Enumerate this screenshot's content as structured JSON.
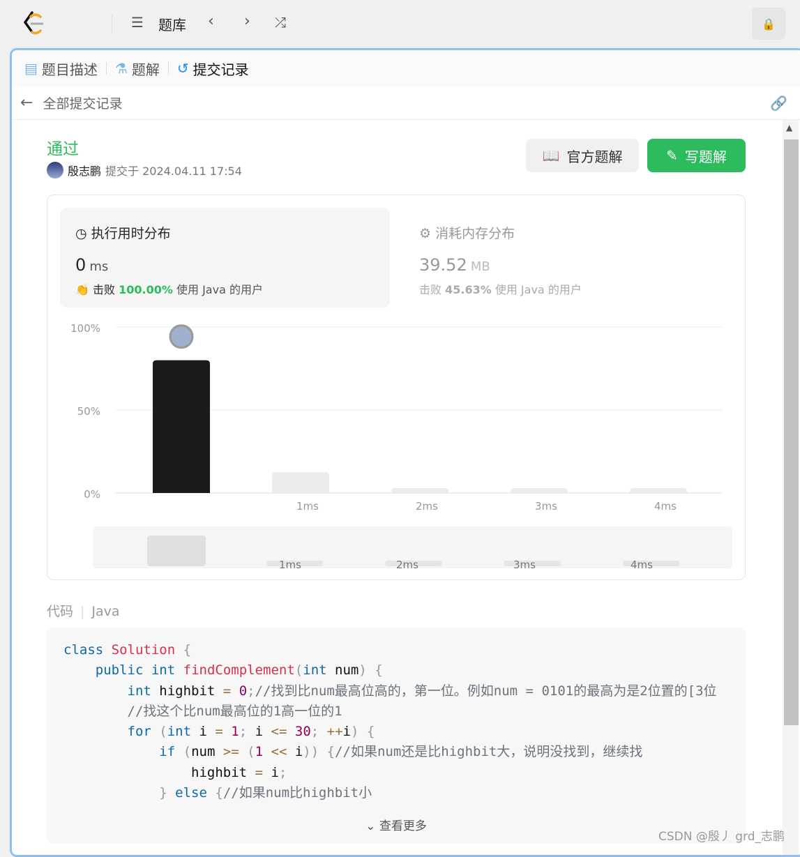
{
  "topbar": {
    "problem_list": "题库"
  },
  "tabs": [
    {
      "label": "题目描述"
    },
    {
      "label": "题解"
    },
    {
      "label": "提交记录"
    }
  ],
  "back_label": "全部提交记录",
  "submission": {
    "status": "通过",
    "status_color": "#2cbb5d",
    "user": "殷志鹏",
    "submitted_at": "提交于 2024.04.11 17:54"
  },
  "buttons": {
    "official": "官方题解",
    "write": "写题解"
  },
  "runtime": {
    "title": "执行用时分布",
    "value": "0",
    "unit": "ms",
    "beat_prefix": "击败",
    "beat_pct": "100.00%",
    "beat_suffix": "使用 Java 的用户"
  },
  "memory": {
    "title": "消耗内存分布",
    "value": "39.52",
    "unit": "MB",
    "beat_prefix": "击败",
    "beat_pct": "45.63%",
    "beat_suffix": "使用 Java 的用户"
  },
  "chart_data": {
    "type": "bar",
    "categories": [
      "0ms",
      "1ms",
      "2ms",
      "3ms",
      "4ms"
    ],
    "tick_labels": [
      "",
      "1ms",
      "2ms",
      "3ms",
      "4ms"
    ],
    "values": [
      80,
      12.5,
      3,
      3,
      3
    ],
    "yticks": [
      "100%",
      "50%",
      "0%"
    ],
    "ylim": [
      0,
      100
    ],
    "grid": true,
    "highlight_index": 0
  },
  "code_header": {
    "label": "代码",
    "lang": "Java"
  },
  "code": [
    [
      [
        "class",
        "kw"
      ],
      [
        " ",
        ""
      ],
      [
        "Solution",
        "fn"
      ],
      [
        " {",
        "pn"
      ]
    ],
    [
      [
        "    ",
        ""
      ],
      [
        "public",
        "kw"
      ],
      [
        " ",
        ""
      ],
      [
        "int",
        "kw"
      ],
      [
        " ",
        ""
      ],
      [
        "findComplement",
        "fn"
      ],
      [
        "(",
        "pn"
      ],
      [
        "int",
        "kw"
      ],
      [
        " num",
        "id"
      ],
      [
        ") {",
        "pn"
      ]
    ],
    [
      [
        "        ",
        ""
      ],
      [
        "int",
        "kw"
      ],
      [
        " highbit ",
        "id"
      ],
      [
        "=",
        "op"
      ],
      [
        " ",
        ""
      ],
      [
        "0",
        "nm"
      ],
      [
        ";",
        "pn"
      ],
      [
        "//找到比num最高位高的，第一位。例如num = 0101的最高为是2位置的[3位",
        "cm"
      ]
    ],
    [
      [
        "        ",
        ""
      ],
      [
        "//找这个比num最高位的1高一位的1",
        "cm"
      ]
    ],
    [
      [
        "        ",
        ""
      ],
      [
        "for",
        "kw"
      ],
      [
        " (",
        "pn"
      ],
      [
        "int",
        "kw"
      ],
      [
        " i ",
        "id"
      ],
      [
        "=",
        "op"
      ],
      [
        " ",
        ""
      ],
      [
        "1",
        "nm"
      ],
      [
        "; ",
        "pn"
      ],
      [
        "i ",
        "id"
      ],
      [
        "<=",
        "op"
      ],
      [
        " ",
        ""
      ],
      [
        "30",
        "nm"
      ],
      [
        "; ",
        "pn"
      ],
      [
        "++",
        "op"
      ],
      [
        "i",
        "id"
      ],
      [
        ") {",
        "pn"
      ]
    ],
    [
      [
        "            ",
        ""
      ],
      [
        "if",
        "kw"
      ],
      [
        " (",
        "pn"
      ],
      [
        "num ",
        "id"
      ],
      [
        ">=",
        "op"
      ],
      [
        " (",
        "pn"
      ],
      [
        "1",
        "nm"
      ],
      [
        " ",
        ""
      ],
      [
        "<<",
        "op"
      ],
      [
        " i",
        "id"
      ],
      [
        ")) {",
        "pn"
      ],
      [
        "//如果num还是比highbit大，说明没找到，继续找",
        "cm"
      ]
    ],
    [
      [
        "                ",
        ""
      ],
      [
        "highbit ",
        "id"
      ],
      [
        "=",
        "op"
      ],
      [
        " i",
        "id"
      ],
      [
        ";",
        "pn"
      ]
    ],
    [
      [
        "            ",
        ""
      ],
      [
        "} ",
        "pn"
      ],
      [
        "else",
        "kw"
      ],
      [
        " {",
        "pn"
      ],
      [
        "//如果num比highbit小",
        "cm"
      ]
    ]
  ],
  "show_more": "查看更多",
  "watermark": "CSDN @殷丿 grd_志鹏"
}
